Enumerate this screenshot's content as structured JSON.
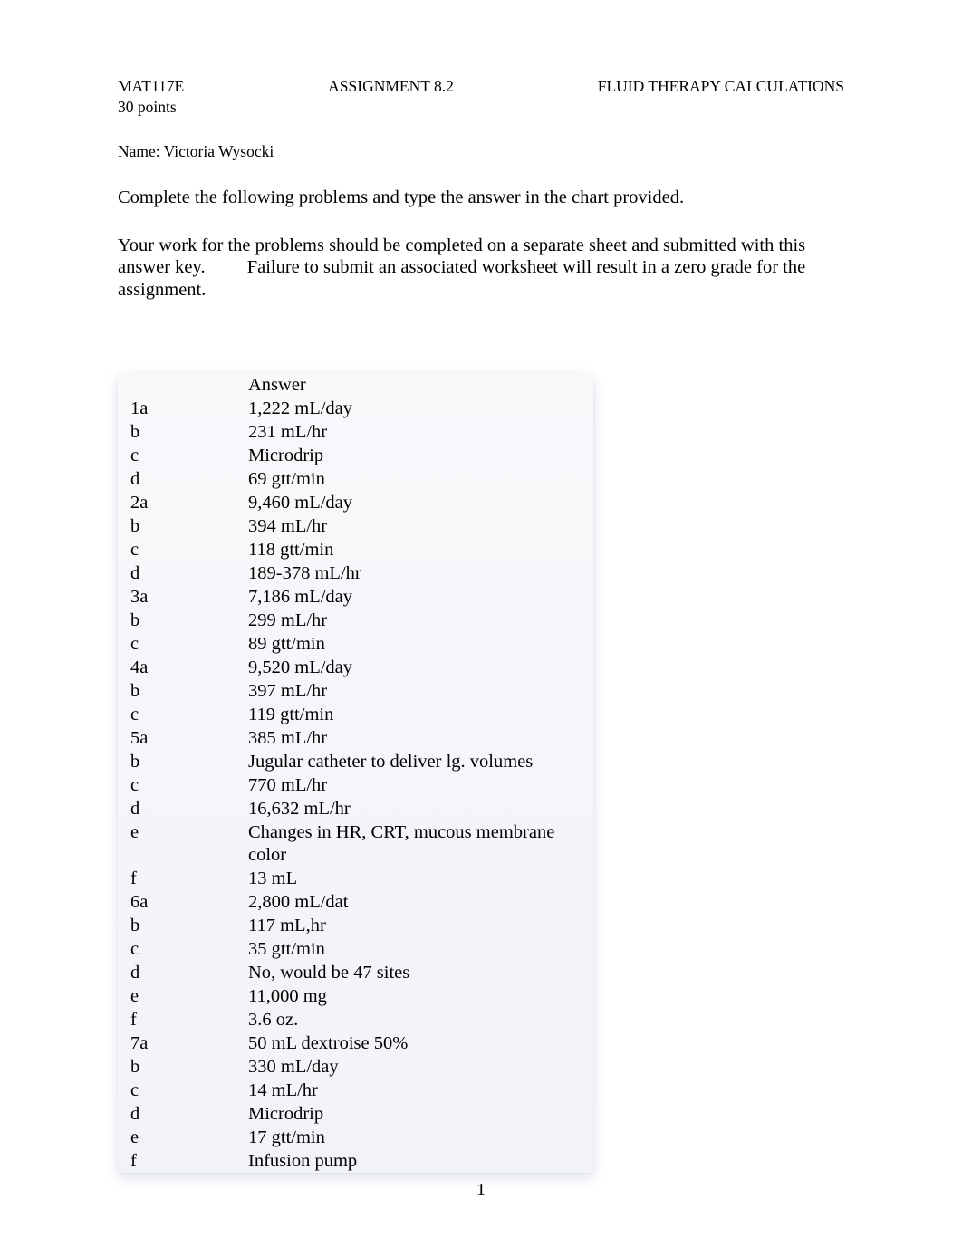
{
  "header": {
    "left": "MAT117E",
    "center": "ASSIGNMENT 8.2",
    "right": "FLUID THERAPY CALCULATIONS"
  },
  "points": "30 points",
  "name_label": "Name: ",
  "name_value": "Victoria Wysocki",
  "instruction1": "Complete the following problems and type the answer in the chart provided.",
  "instruction2": "Your work for the problems should be completed on a separate sheet and submitted with this answer key.         Failure to submit an associated worksheet will result in a zero grade for the assignment.",
  "table_header_answer": "Answer",
  "rows": [
    {
      "label": "1a",
      "answer": "1,222 mL/day"
    },
    {
      "label": "b",
      "answer": "231 mL/hr"
    },
    {
      "label": "c",
      "answer": "Microdrip"
    },
    {
      "label": "d",
      "answer": "69 gtt/min"
    },
    {
      "label": "2a",
      "answer": "9,460 mL/day"
    },
    {
      "label": "b",
      "answer": "394 mL/hr"
    },
    {
      "label": "c",
      "answer": "118 gtt/min"
    },
    {
      "label": "d",
      "answer": "189-378 mL/hr"
    },
    {
      "label": "3a",
      "answer": "7,186 mL/day"
    },
    {
      "label": "b",
      "answer": "299 mL/hr"
    },
    {
      "label": "c",
      "answer": "89 gtt/min"
    },
    {
      "label": "4a",
      "answer": "9,520 mL/day"
    },
    {
      "label": "b",
      "answer": "397 mL/hr"
    },
    {
      "label": "c",
      "answer": "119 gtt/min"
    },
    {
      "label": "5a",
      "answer": "385 mL/hr"
    },
    {
      "label": "b",
      "answer": "Jugular catheter to deliver lg. volumes"
    },
    {
      "label": "c",
      "answer": "770 mL/hr"
    },
    {
      "label": "d",
      "answer": "16,632 mL/hr"
    },
    {
      "label": "e",
      "answer": "Changes in HR, CRT, mucous membrane color"
    },
    {
      "label": "f",
      "answer": "13 mL"
    },
    {
      "label": "6a",
      "answer": "2,800 mL/dat"
    },
    {
      "label": "b",
      "answer": "117 mL,hr"
    },
    {
      "label": "c",
      "answer": "35 gtt/min"
    },
    {
      "label": "d",
      "answer": "No, would be 47 sites"
    },
    {
      "label": "e",
      "answer": "11,000 mg"
    },
    {
      "label": "f",
      "answer": "3.6 oz."
    },
    {
      "label": "7a",
      "answer": "50 mL dextroise 50%"
    },
    {
      "label": "b",
      "answer": "330 mL/day"
    },
    {
      "label": "c",
      "answer": "14 mL/hr"
    },
    {
      "label": "d",
      "answer": "Microdrip"
    },
    {
      "label": "e",
      "answer": "17 gtt/min"
    },
    {
      "label": "f",
      "answer": "Infusion pump"
    }
  ],
  "page_number": "1"
}
